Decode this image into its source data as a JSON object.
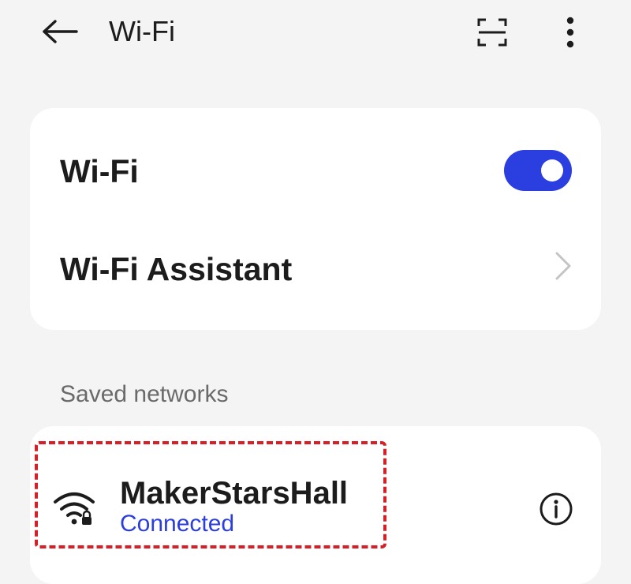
{
  "header": {
    "title": "Wi-Fi",
    "back_icon": "arrow-left-icon",
    "scan_icon": "scan-qr-icon",
    "more_icon": "more-vertical-icon"
  },
  "main_card": {
    "wifi_row": {
      "label": "Wi-Fi",
      "toggle_on": true
    },
    "assistant_row": {
      "label": "Wi-Fi Assistant",
      "icon": "chevron-right-icon"
    }
  },
  "saved_networks": {
    "header": "Saved networks",
    "items": [
      {
        "name": "MakerStarsHall",
        "status": "Connected",
        "icon": "wifi-lock-icon",
        "info_icon": "info-icon"
      }
    ]
  },
  "colors": {
    "accent": "#2b3ee0",
    "background": "#f4f4f4",
    "card": "#ffffff",
    "highlight": "#d71f27"
  }
}
